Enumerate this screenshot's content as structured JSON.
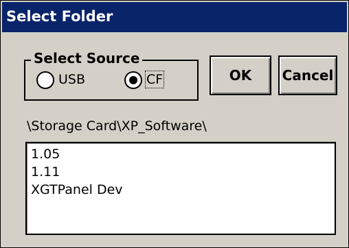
{
  "dialog": {
    "title": "Select Folder"
  },
  "source": {
    "group_label": "Select Source",
    "options": [
      {
        "label": "USB",
        "selected": false
      },
      {
        "label": "CF",
        "selected": true
      }
    ]
  },
  "buttons": {
    "ok_label": "OK",
    "cancel_label": "Cancel"
  },
  "current_path": "\\Storage Card\\XP_Software\\",
  "folders": [
    "1.05",
    "1.11",
    "XGTPanel Dev"
  ]
}
